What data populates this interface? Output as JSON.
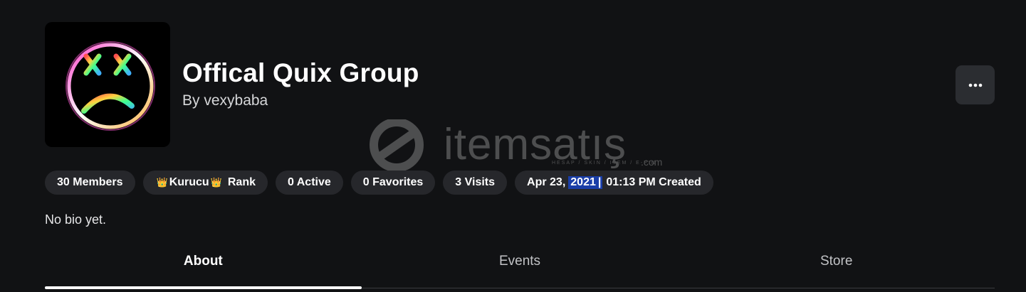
{
  "group": {
    "name": "Offical Quix Group",
    "owner_line": "By vexybaba",
    "bio": "No bio yet."
  },
  "stats": {
    "members": "30 Members",
    "rank_prefix_icon": "crown-icon",
    "rank_name": "Kurucu",
    "rank_label": "Rank",
    "active": "0 Active",
    "favorites": "0 Favorites",
    "visits": "3 Visits",
    "created_date_prefix": "Apr 23,",
    "created_year": "2021",
    "created_separator": "|",
    "created_rest": "01:13 PM Created"
  },
  "more_button": {
    "icon": "ellipsis-icon"
  },
  "tabs": [
    {
      "label": "About",
      "active": true
    },
    {
      "label": "Events",
      "active": false
    },
    {
      "label": "Store",
      "active": false
    }
  ],
  "watermark": {
    "text": "itemsatış",
    "subtext": "HESAP / SKIN / ITEM / E-PIN",
    "suffix": ".com"
  },
  "colors": {
    "background": "#111214",
    "pill": "#26272b",
    "selection": "#1a3ea8",
    "button": "#2b2d31"
  }
}
